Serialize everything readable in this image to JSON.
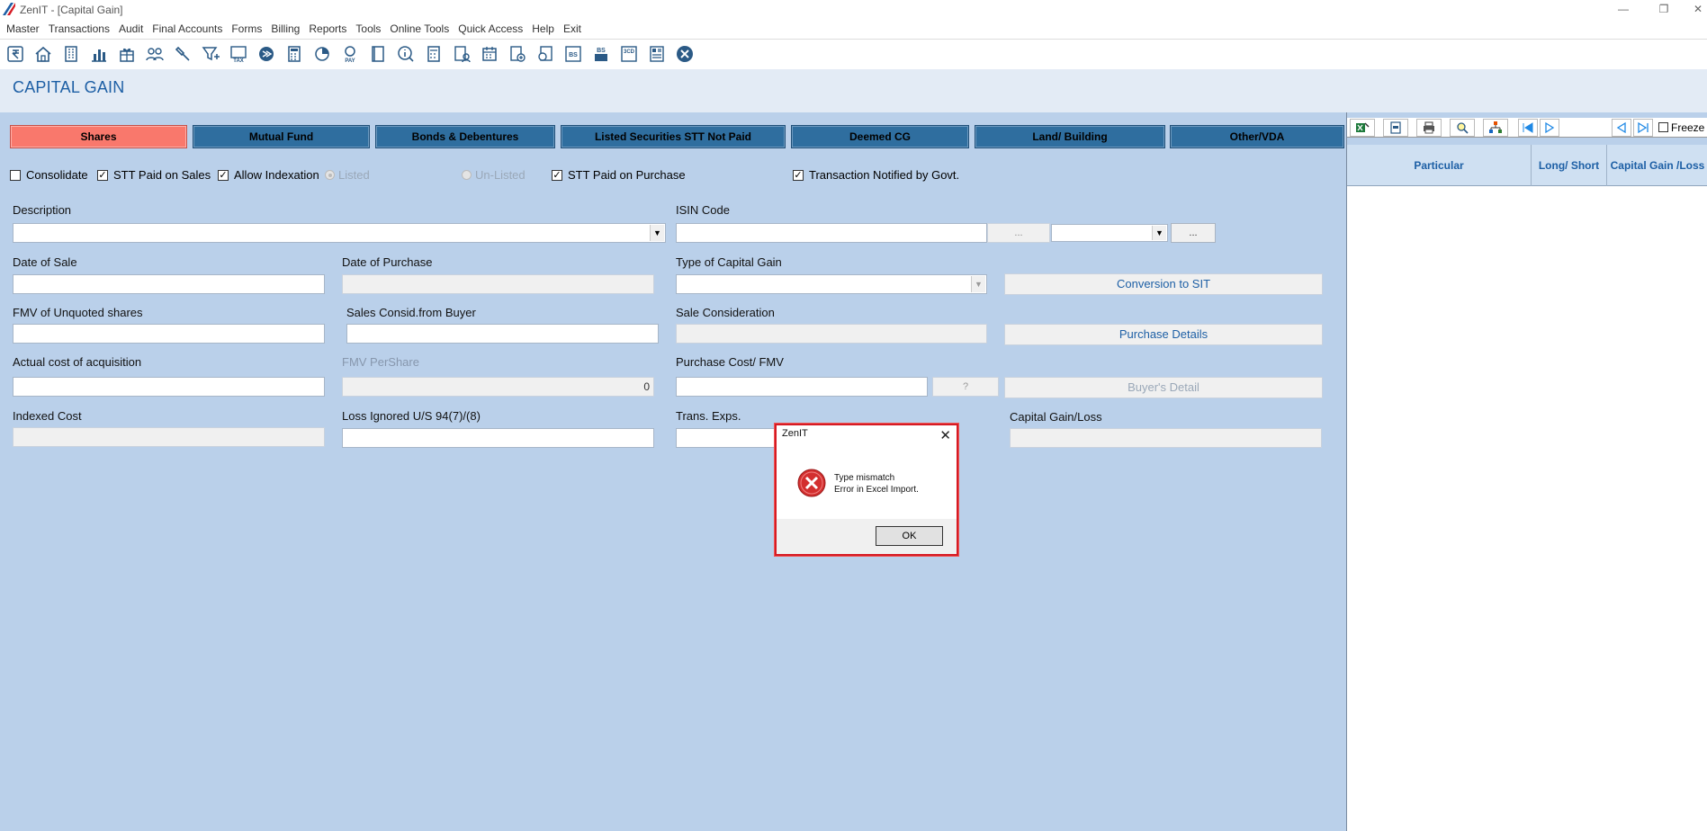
{
  "window": {
    "title": "ZenIT - [Capital Gain]",
    "minimize": "—",
    "restore": "❐",
    "close": "✕"
  },
  "menu": [
    "Master",
    "Transactions",
    "Audit",
    "Final Accounts",
    "Forms",
    "Billing",
    "Reports",
    "Tools",
    "Online Tools",
    "Quick Access",
    "Help",
    "Exit"
  ],
  "toolbar_icons": [
    "rupee-icon",
    "home-icon",
    "building-icon",
    "bar-chart-icon",
    "gift-icon",
    "users-icon",
    "hammer-icon",
    "filter-icon",
    "tax-icon",
    "arrow-circle-icon",
    "calculator-icon",
    "pie-chart-icon",
    "pay-icon",
    "book-icon",
    "info-icon",
    "calculator2-icon",
    "user-doc-icon",
    "calendar-icon",
    "doc-add-icon",
    "doc-search-icon",
    "bs-icon",
    "bs-sheet-icon",
    "3cd-icon",
    "form-icon",
    "close-circle-icon"
  ],
  "toolbar_texts": {
    "tax": "TAX",
    "pay": "PAY",
    "bs": "BS",
    "bs2": "BS",
    "cd": "3CD"
  },
  "header": {
    "title": "CAPITAL GAIN"
  },
  "tabs": [
    "Shares",
    "Mutual Fund",
    "Bonds & Debentures",
    "Listed Securities STT Not Paid",
    "Deemed CG",
    "Land/ Building",
    "Other/VDA"
  ],
  "options": {
    "consolidate": "Consolidate",
    "stt_sales": "STT Paid on Sales",
    "allow_indexation": "Allow Indexation",
    "listed": "Listed",
    "unlisted": "Un-Listed",
    "stt_purchase": "STT Paid on Purchase",
    "notified": "Transaction Notified by Govt."
  },
  "fields": {
    "description": "Description",
    "isin": "ISIN Code",
    "date_sale": "Date of Sale",
    "date_purchase": "Date of Purchase",
    "type_cg": "Type of Capital Gain",
    "fmv_unquoted": "FMV of Unquoted shares",
    "sales_consid_buyer": "Sales Consid.from Buyer",
    "sale_consideration": "Sale Consideration",
    "actual_cost": "Actual cost of acquisition",
    "fmv_per_share": "FMV PerShare",
    "fmv_per_share_value": "0",
    "purchase_cost": "Purchase Cost/ FMV",
    "indexed_cost": "Indexed Cost",
    "loss_ignored": "Loss Ignored U/S 94(7)/(8)",
    "trans_exps": "Trans. Exps.",
    "capital_gain_loss": "Capital Gain/Loss"
  },
  "buttons": {
    "ellipsis": "...",
    "ellipsis2": "...",
    "question": "?",
    "conversion_sit": "Conversion to SIT",
    "purchase_details": "Purchase Details",
    "buyers_detail": "Buyer's Detail"
  },
  "right_panel": {
    "freeze": "Freeze",
    "columns": [
      "Particular",
      "Long/ Short",
      "Capital Gain /Loss"
    ]
  },
  "dialog": {
    "title": "ZenIT",
    "line1": "Type mismatch",
    "line2": "Error in Excel Import.",
    "ok": "OK"
  },
  "colors": {
    "panel_bg": "#bad0ea",
    "tab_blue": "#2f6e9f",
    "tab_active": "#f9786c",
    "title_blue": "#1d5fa5",
    "error_red": "#d61b24"
  }
}
